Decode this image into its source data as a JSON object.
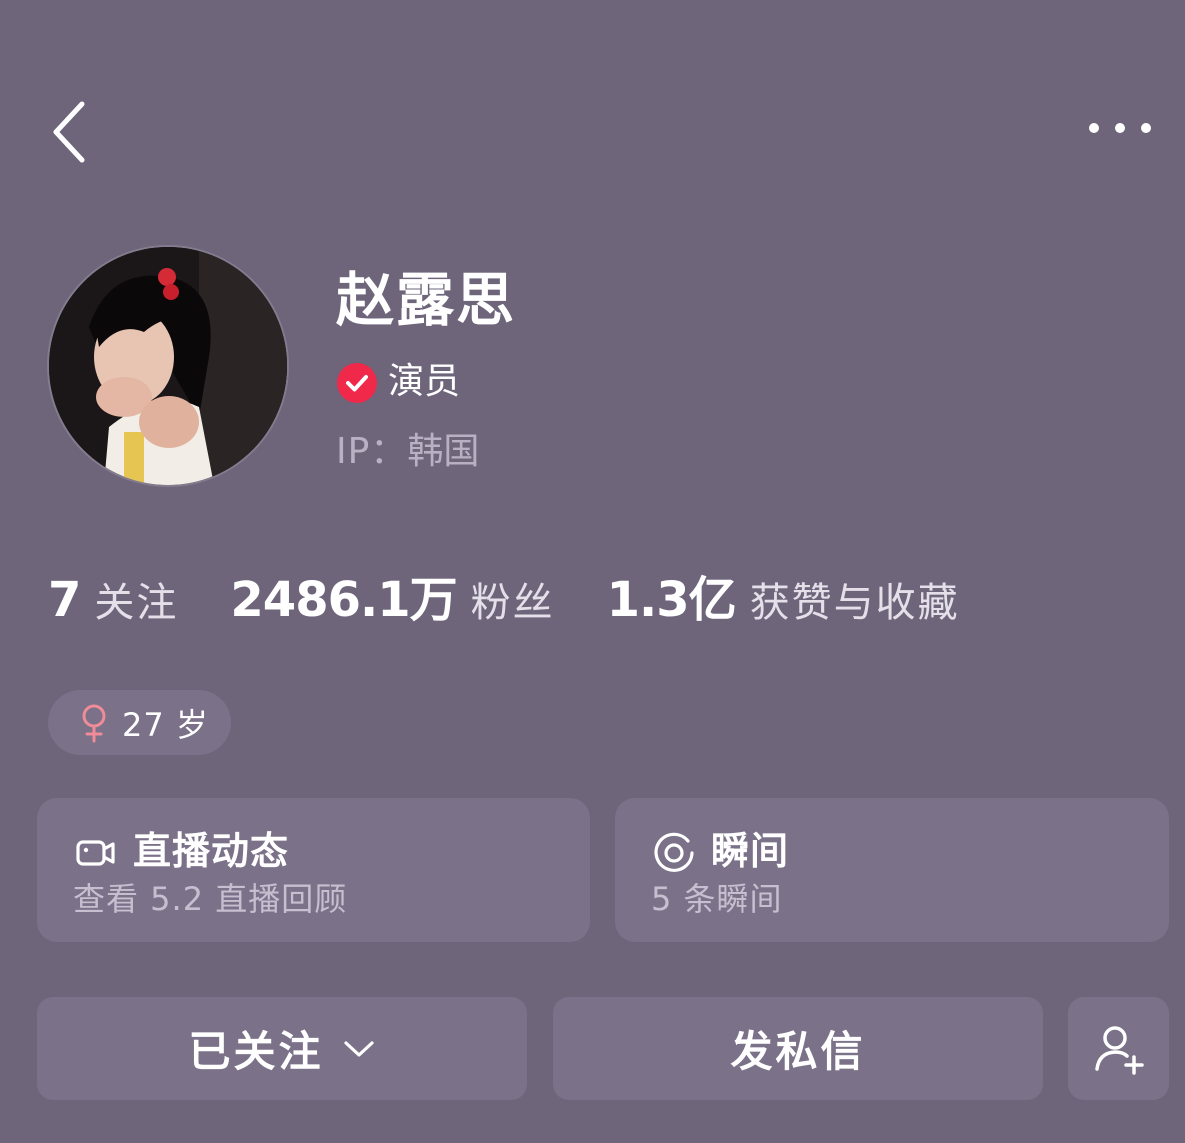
{
  "colors": {
    "background": "#6e657b",
    "card": "#7b7189",
    "verify_badge": "#f0284a",
    "female_icon": "#f08b98",
    "muted_text": "#b9b1c3"
  },
  "header": {
    "back_icon": "chevron-left-icon",
    "more_icon": "more-dots-icon"
  },
  "profile": {
    "name": "赵露思",
    "verified_icon": "verified-check-icon",
    "role": "演员",
    "ip_label": "IP：",
    "ip_location": "韩国"
  },
  "stats": [
    {
      "value": "7",
      "label": "关注"
    },
    {
      "value": "2486.1万",
      "label": "粉丝"
    },
    {
      "value": "1.3亿",
      "label": "获赞与收藏"
    }
  ],
  "tags": {
    "gender_icon": "female-icon",
    "age": "27 岁"
  },
  "cards": {
    "live": {
      "icon": "video-camera-icon",
      "title": "直播动态",
      "subtitle": "查看 5.2 直播回顾"
    },
    "moment": {
      "icon": "moment-ring-icon",
      "title": "瞬间",
      "subtitle": "5 条瞬间"
    }
  },
  "actions": {
    "follow_label": "已关注",
    "message_label": "发私信",
    "add_friend_icon": "add-user-icon"
  }
}
